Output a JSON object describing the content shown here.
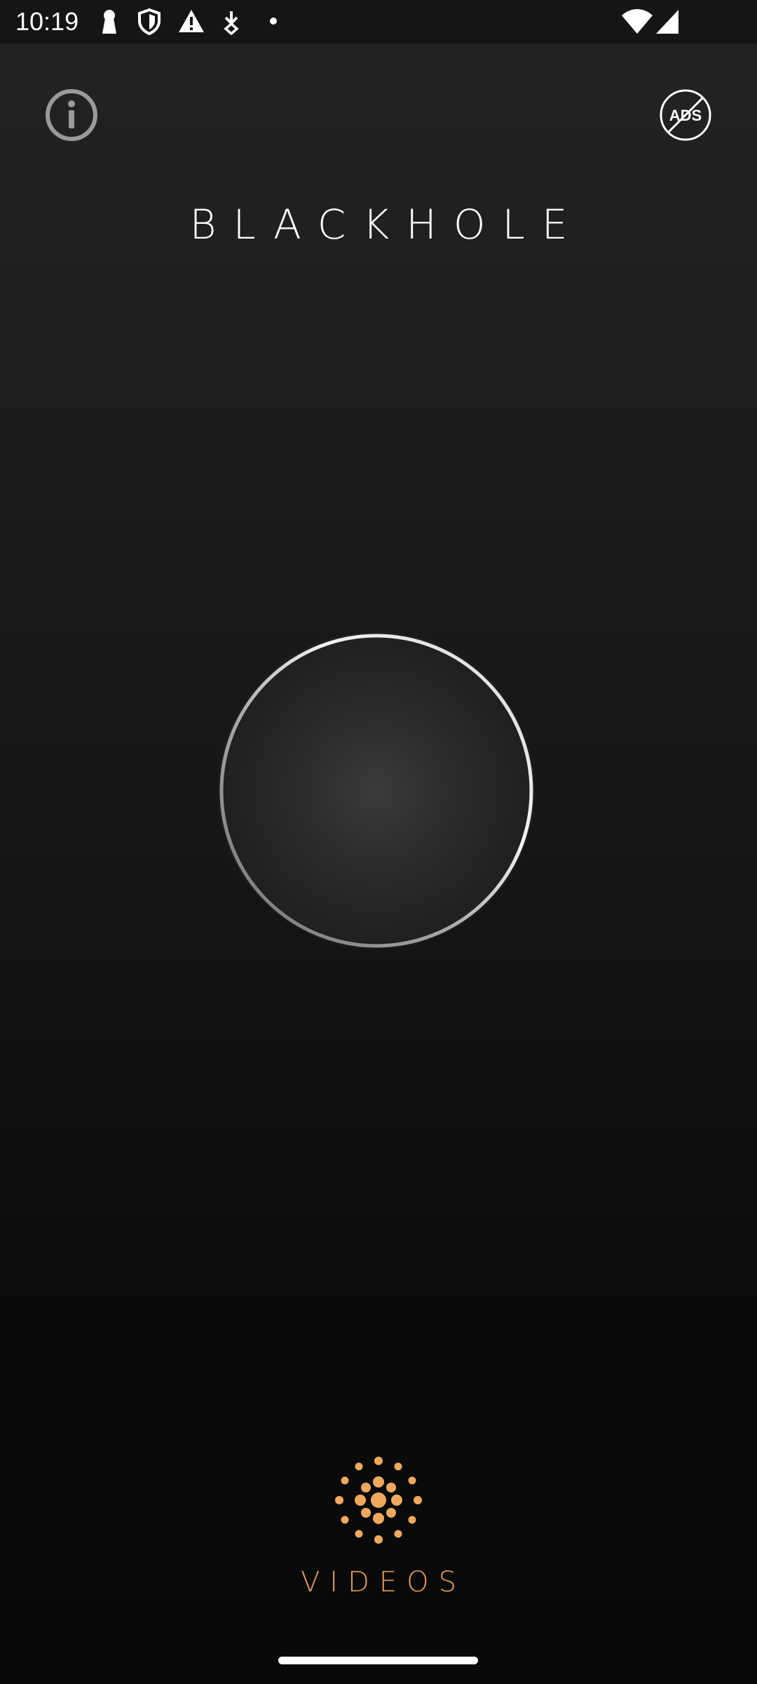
{
  "status_bar": {
    "time": "10:19",
    "icons": [
      "keyhole-icon",
      "shield-icon",
      "warning-icon",
      "download-arrow-icon",
      "dot-icon",
      "wifi-icon",
      "signal-icon"
    ]
  },
  "header": {
    "title": "BLACKHOLE",
    "info_icon": "info-icon",
    "ads_label": "ADS",
    "ads_icon": "no-ads-icon"
  },
  "main": {
    "orb": "blackhole-orb"
  },
  "footer": {
    "videos_label": "VIDEOS",
    "videos_icon": "dots-burst-icon"
  },
  "colors": {
    "accent": "#e49a52",
    "text": "#ffffff",
    "background_top": "#232324",
    "background_bottom": "#0a0909"
  }
}
